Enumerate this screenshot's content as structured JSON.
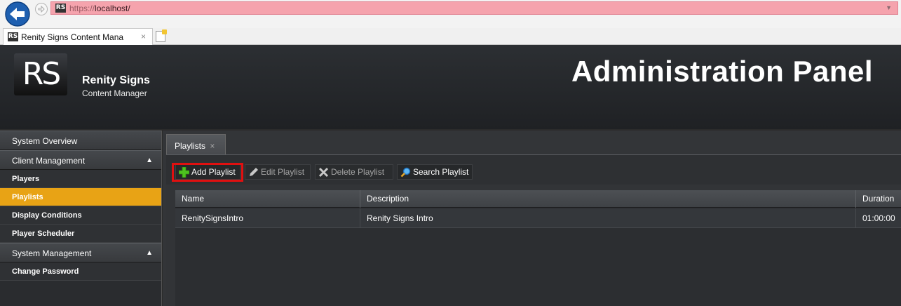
{
  "browser": {
    "url_prefix": "https://",
    "url_host": "localhost/",
    "favicon_text": "RS",
    "tab_title": "Renity Signs Content Mana",
    "tab_close": "×"
  },
  "header": {
    "logo_text": "RS",
    "brand_name": "Renity Signs",
    "brand_sub": "Content Manager",
    "panel_title": "Administration Panel"
  },
  "sidebar": {
    "system_overview": "System Overview",
    "client_management": "Client Management",
    "client_items": [
      "Players",
      "Playlists",
      "Display Conditions",
      "Player Scheduler"
    ],
    "active_item": "Playlists",
    "system_management": "System Management",
    "system_items": [
      "Change Password"
    ],
    "collapse_glyph": "▲"
  },
  "main": {
    "tab_label": "Playlists",
    "tab_close": "×",
    "toolbar": {
      "add": "Add Playlist",
      "edit": "Edit Playlist",
      "delete": "Delete Playlist",
      "search": "Search Playlist"
    },
    "grid": {
      "columns": [
        "Name",
        "Description",
        "Duration"
      ],
      "rows": [
        {
          "name": "RenitySignsIntro",
          "description": "Renity Signs Intro",
          "duration": "01:00:00"
        }
      ]
    }
  },
  "colors": {
    "active_item": "#e8a315",
    "highlight_border": "#e01010",
    "url_bar": "#f5a3ad"
  }
}
